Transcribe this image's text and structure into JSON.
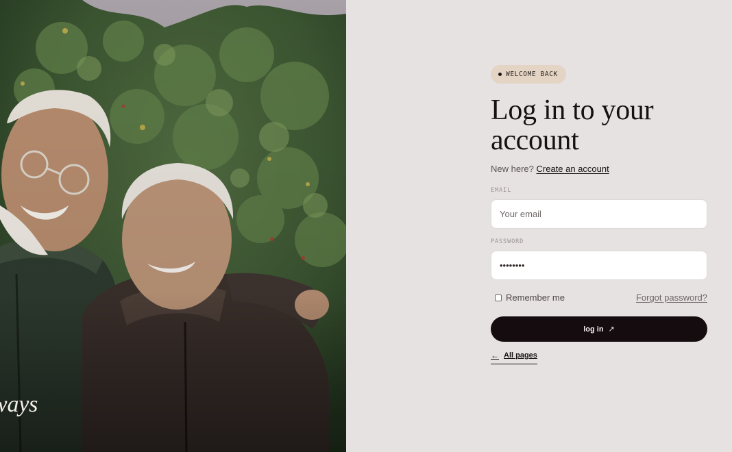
{
  "photo": {
    "caption": "ways",
    "alt": "smiling elderly couple"
  },
  "badge": {
    "label": "WELCOME BACK"
  },
  "heading": {
    "line1": "Log in to your",
    "line2": "account"
  },
  "signup": {
    "prompt": "New here?",
    "link": "Create an account"
  },
  "email": {
    "label": "EMAIL",
    "placeholder": "Your email",
    "value": ""
  },
  "password": {
    "label": "PASSWORD",
    "value": "••••••••"
  },
  "remember": {
    "label": "Remember me",
    "checked": false
  },
  "forgot": {
    "label": "Forgot password?"
  },
  "login_button": {
    "label": "log in",
    "icon": "arrow-up-right-icon"
  },
  "back_link": {
    "label": "All pages",
    "icon": "arrow-left-icon"
  },
  "colors": {
    "background": "#e6e2e2",
    "button": "#140c0e",
    "badge": "#e3d4c4"
  }
}
